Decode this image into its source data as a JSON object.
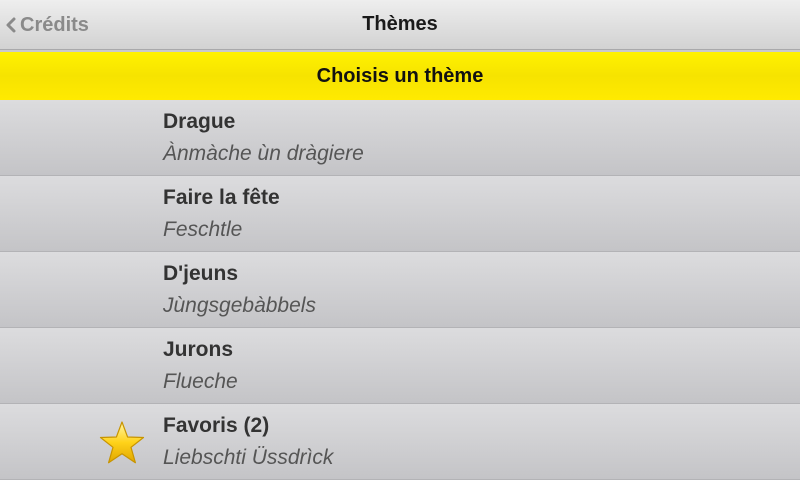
{
  "navbar": {
    "back_label": "Crédits",
    "title": "Thèmes"
  },
  "banner": {
    "label": "Choisis un thème"
  },
  "themes": [
    {
      "title": "Drague",
      "subtitle": "Ànmàche ùn dràgiere"
    },
    {
      "title": "Faire la fête",
      "subtitle": "Feschtle"
    },
    {
      "title": "D'jeuns",
      "subtitle": "Jùngsgebàbbels"
    },
    {
      "title": "Jurons",
      "subtitle": "Flueche"
    },
    {
      "title": "Favoris (2)",
      "subtitle": "Liebschti Üssdrìck",
      "icon": "star-icon"
    }
  ],
  "colors": {
    "banner": "#ffee00",
    "star": "#f5c400"
  }
}
